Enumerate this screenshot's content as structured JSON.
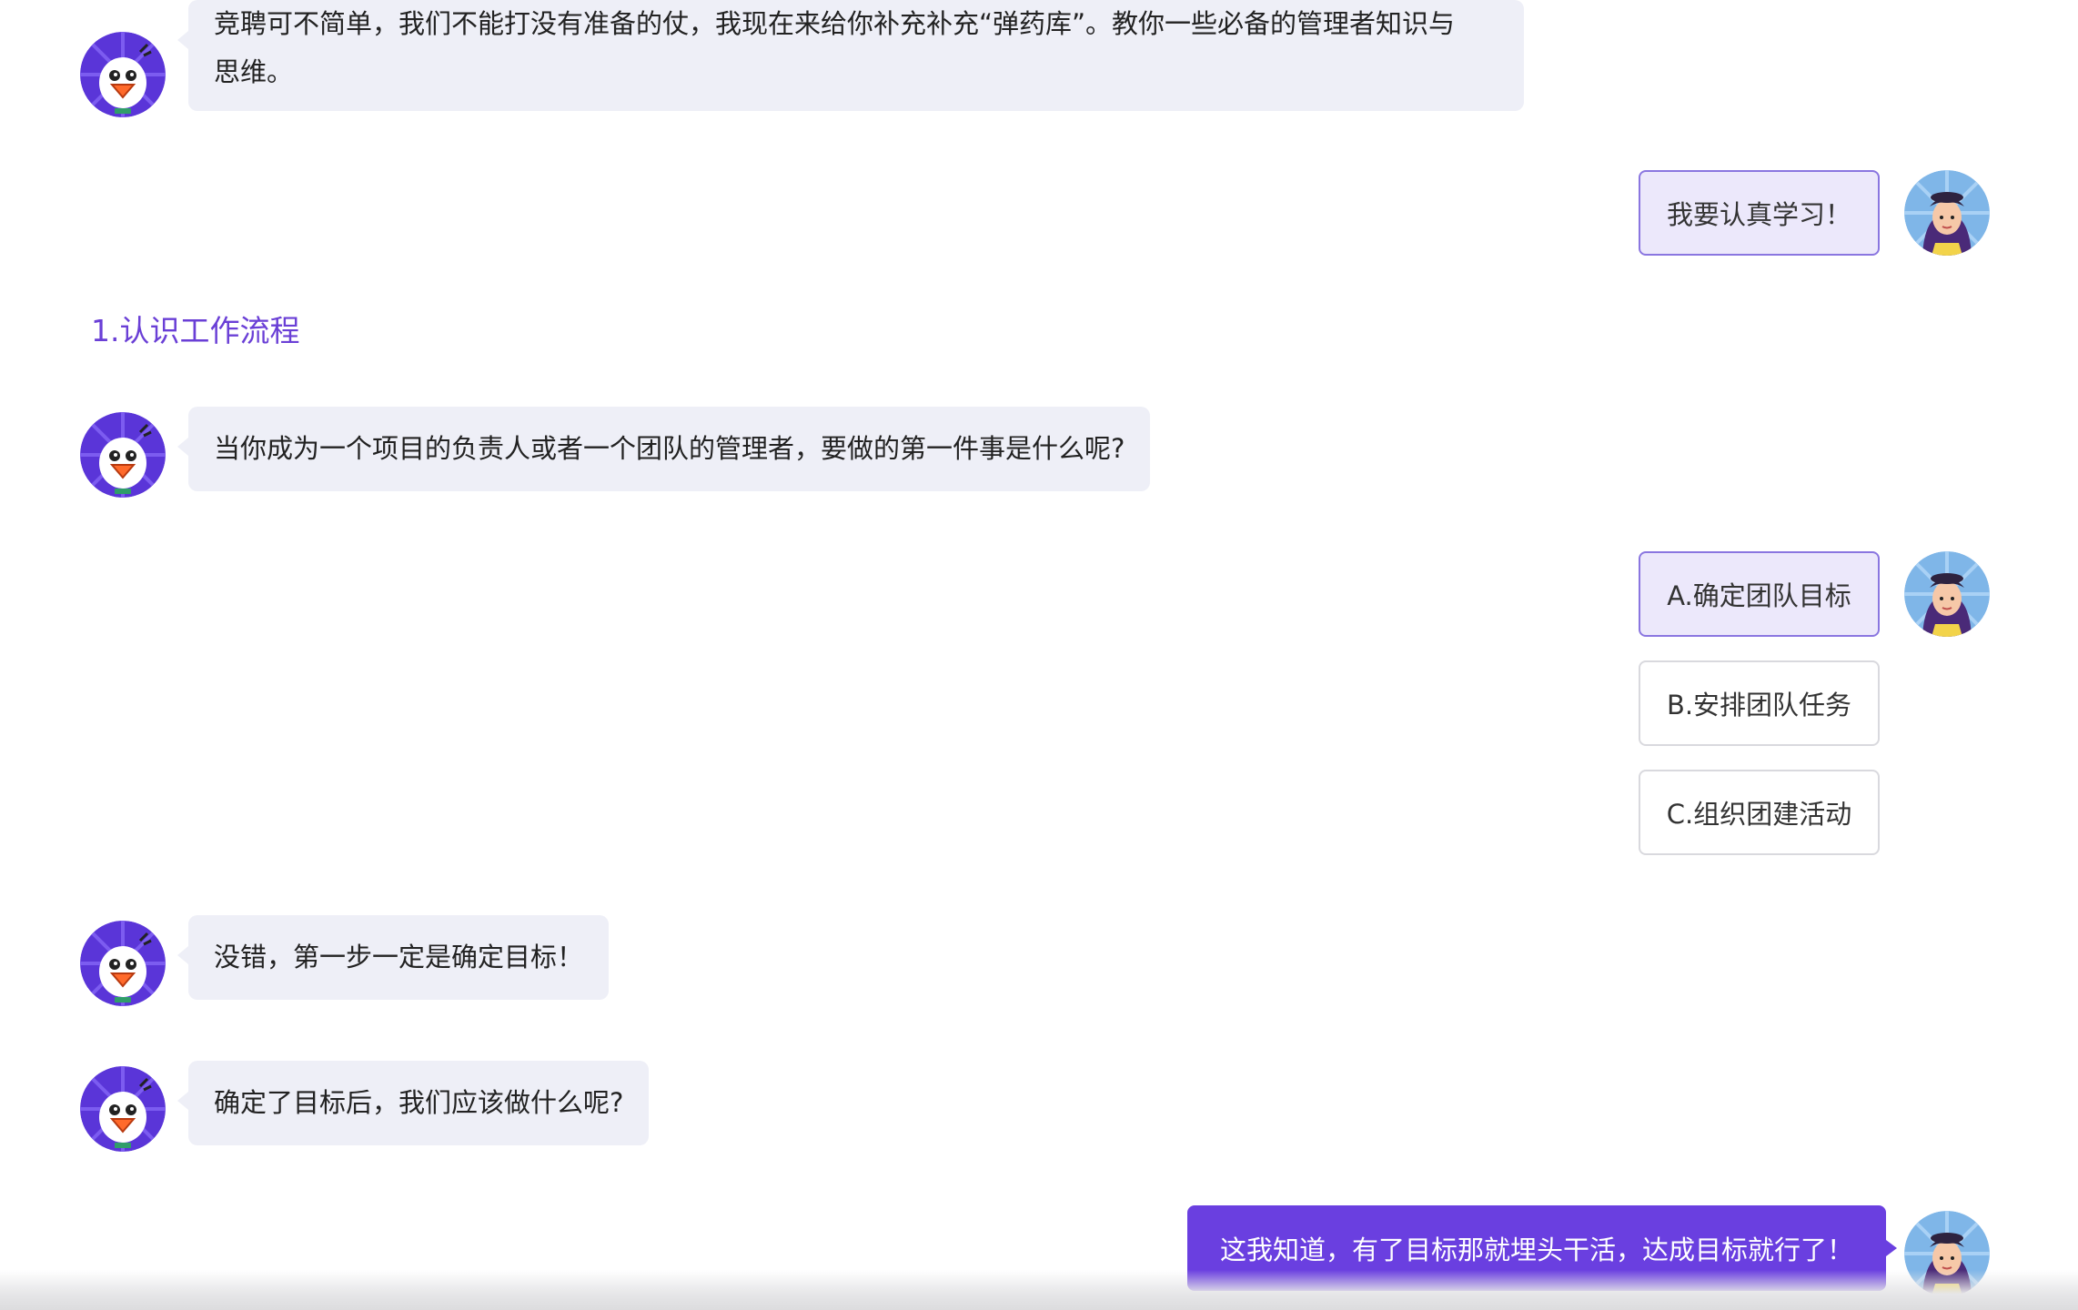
{
  "messages": {
    "intro_line1": "竞聘可不简单，我们不能打没有准备的仗，我现在来给你补充补充“弹药库”。教你一些必备的管理者知识与",
    "intro_line2": "思维。",
    "user_study": "我要认真学习！",
    "section_title": "1.认识工作流程",
    "question1": "当你成为一个项目的负责人或者一个团队的管理者，要做的第一件事是什么呢?",
    "option_a": "A.确定团队目标",
    "option_b": "B.安排团队任务",
    "option_c": "C.组织团建活动",
    "reply1": "没错，第一步一定是确定目标！",
    "question2": "确定了目标后，我们应该做什么呢?",
    "user_answer": "这我知道，有了目标那就埋头干活，达成目标就行了！"
  },
  "colors": {
    "accent": "#6a3fe0",
    "section_title": "#6a3fd6",
    "bot_bubble": "#eeeff7",
    "selected_option_bg": "#ece8fb",
    "selected_option_border": "#8a76e0"
  },
  "avatars": {
    "bot": "snowman-mascot-avatar",
    "user": "girl-avatar"
  }
}
